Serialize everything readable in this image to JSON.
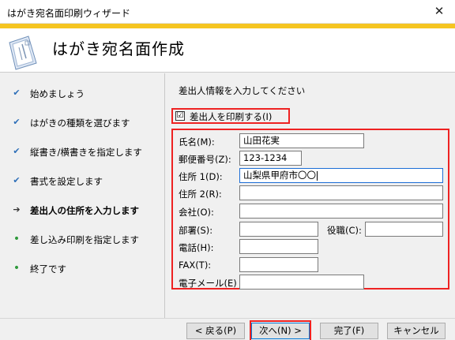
{
  "window": {
    "title": "はがき宛名面印刷ウィザード",
    "close_glyph": "✕"
  },
  "header": {
    "title": "はがき宛名面作成"
  },
  "steps": [
    {
      "label": "始めましょう",
      "mark": "✔"
    },
    {
      "label": "はがきの種類を選びます",
      "mark": "✔"
    },
    {
      "label": "縦書き/横書きを指定します",
      "mark": "✔"
    },
    {
      "label": "書式を設定します",
      "mark": "✔"
    },
    {
      "label": "差出人の住所を入力します",
      "mark": "➔"
    },
    {
      "label": "差し込み印刷を指定します",
      "mark": "•"
    },
    {
      "label": "終了です",
      "mark": "•"
    }
  ],
  "main": {
    "instruction": "差出人情報を入力してください",
    "print_sender": {
      "label": "差出人を印刷する(I)",
      "checked": "☑"
    },
    "fields": {
      "name": {
        "label": "氏名(M):",
        "value": "山田花実"
      },
      "postal": {
        "label": "郵便番号(Z):",
        "value": "123-1234"
      },
      "address1": {
        "label": "住所 1(D):",
        "value": "山梨県甲府市〇〇"
      },
      "address2": {
        "label": "住所 2(R):",
        "value": ""
      },
      "company": {
        "label": "会社(O):",
        "value": ""
      },
      "department": {
        "label": "部署(S):",
        "value": ""
      },
      "title": {
        "label": "役職(C):",
        "value": ""
      },
      "phone": {
        "label": "電話(H):",
        "value": ""
      },
      "fax": {
        "label": "FAX(T):",
        "value": ""
      },
      "email": {
        "label": "電子メール(E)",
        "value": ""
      }
    }
  },
  "footer": {
    "back": "< 戻る(P)",
    "next": "次へ(N) >",
    "finish": "完了(F)",
    "cancel": "キャンセル"
  }
}
